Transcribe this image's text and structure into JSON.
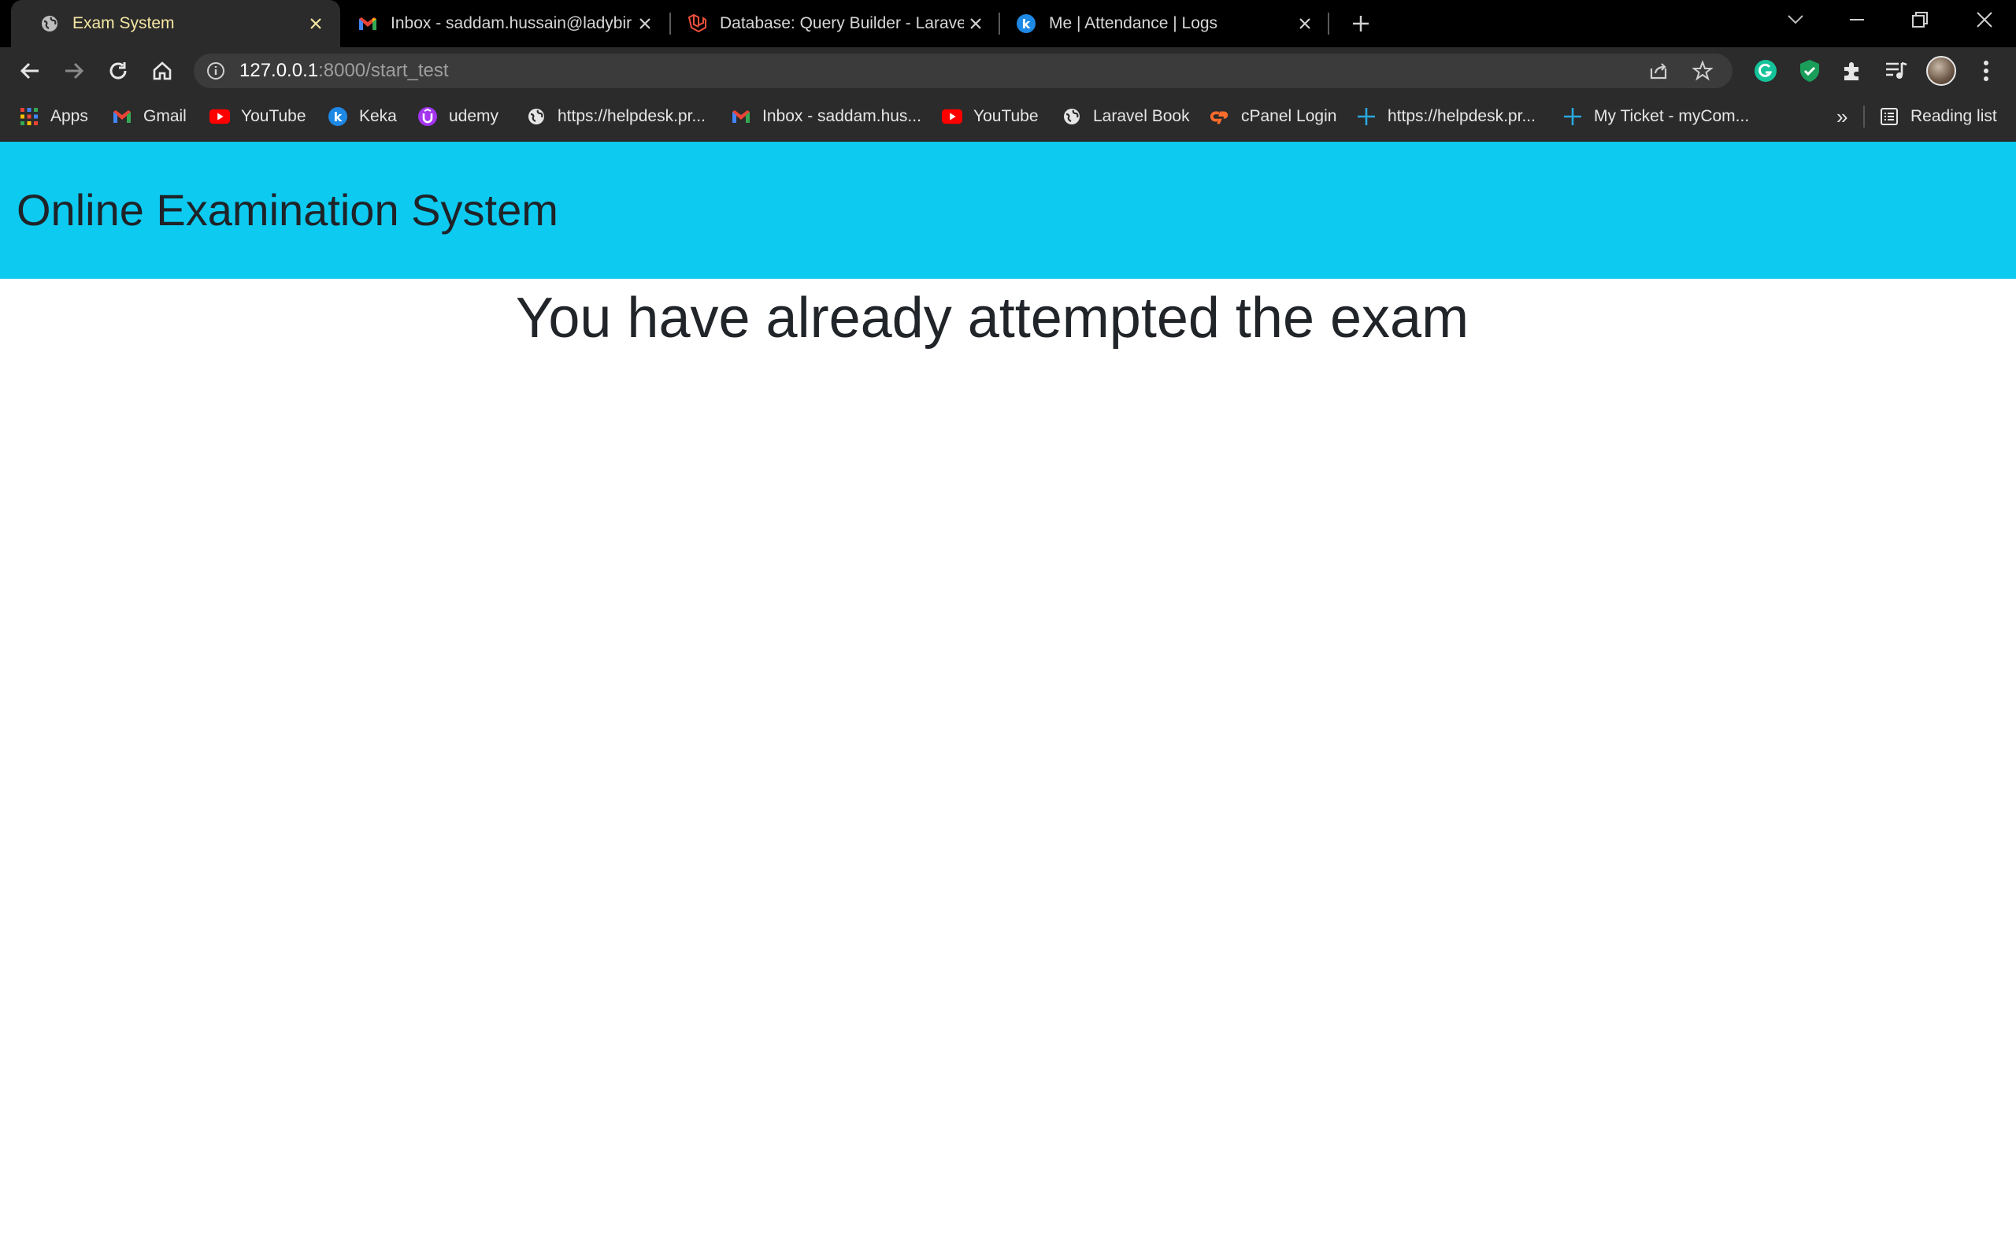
{
  "browser": {
    "tabs": [
      {
        "title": "Exam System",
        "icon": "globe-icon",
        "active": true
      },
      {
        "title": "Inbox - saddam.hussain@ladybir",
        "icon": "gmail-icon",
        "active": false
      },
      {
        "title": "Database: Query Builder - Laravel",
        "icon": "laravel-icon",
        "active": false
      },
      {
        "title": "Me | Attendance | Logs",
        "icon": "keka-icon",
        "active": false
      }
    ],
    "url": {
      "host": "127.0.0.1",
      "path": ":8000/start_test"
    },
    "bookmarks": [
      {
        "label": "Apps",
        "icon": "apps-grid-icon"
      },
      {
        "label": "Gmail",
        "icon": "gmail-icon"
      },
      {
        "label": "YouTube",
        "icon": "youtube-icon"
      },
      {
        "label": "Keka",
        "icon": "keka-icon"
      },
      {
        "label": "udemy",
        "icon": "udemy-icon"
      },
      {
        "label": "https://helpdesk.pr...",
        "icon": "globe-icon"
      },
      {
        "label": "Inbox - saddam.hus...",
        "icon": "gmail-icon"
      },
      {
        "label": "YouTube",
        "icon": "youtube-icon"
      },
      {
        "label": "Laravel Book",
        "icon": "globe-icon"
      },
      {
        "label": "cPanel Login",
        "icon": "cpanel-icon"
      },
      {
        "label": "https://helpdesk.pr...",
        "icon": "plus-cross-icon"
      },
      {
        "label": "My Ticket - myCom...",
        "icon": "plus-cross-icon"
      }
    ],
    "overflow_label": "»",
    "reading_list_label": "Reading list"
  },
  "page": {
    "header_title": "Online Examination System",
    "message": "You have already attempted the exam"
  },
  "colors": {
    "header_bg": "#0dcaf0",
    "chrome_bg": "#2b2b2b",
    "tabstrip_bg": "#000000"
  }
}
